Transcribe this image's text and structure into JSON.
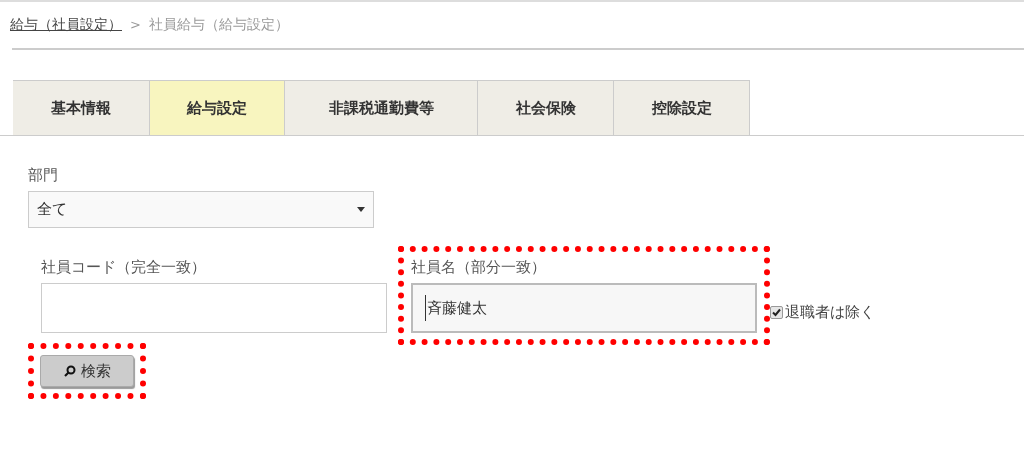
{
  "breadcrumb": {
    "items": [
      {
        "label": "給与（社員設定）",
        "link": true
      },
      {
        "label": "社員給与（給与設定）",
        "link": false
      }
    ],
    "separator": ">"
  },
  "tabs": [
    {
      "label": "基本情報",
      "selected": false
    },
    {
      "label": "給与設定",
      "selected": true
    },
    {
      "label": "非課税通勤費等",
      "selected": false
    },
    {
      "label": "社会保険",
      "selected": false
    },
    {
      "label": "控除設定",
      "selected": false
    }
  ],
  "department": {
    "label": "部門",
    "value": "全て"
  },
  "employee_code": {
    "label": "社員コード（完全一致）",
    "highlighted": false
  },
  "employee_name": {
    "label": "社員名（部分一致）",
    "value": "斉藤健太",
    "highlighted": true
  },
  "exclude_retired": {
    "label": "退職者は除く",
    "checked": true
  },
  "search_button": {
    "label": "検索",
    "highlighted": true
  }
}
